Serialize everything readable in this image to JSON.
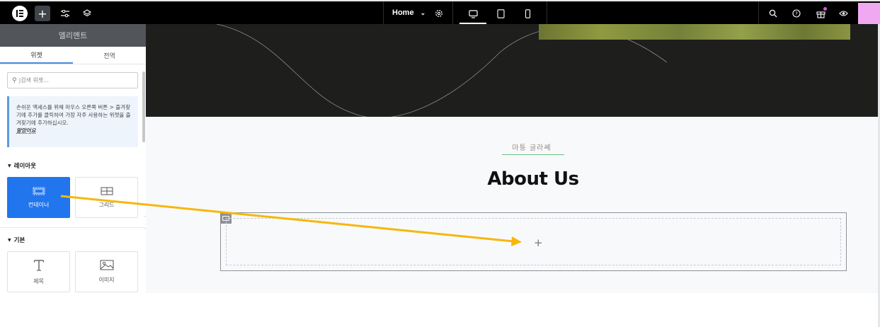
{
  "topbar": {
    "page_selector": "Home",
    "colors": {
      "background": "#000000",
      "accent_pink": "#f0a8f0"
    },
    "icons": [
      "elementor-logo-icon",
      "plus-icon",
      "sliders-icon",
      "layers-icon",
      "chevron-down-icon",
      "gear-icon",
      "desktop-icon",
      "tablet-icon",
      "mobile-icon",
      "search-icon",
      "help-icon",
      "gift-icon",
      "eye-icon"
    ]
  },
  "sidebar": {
    "title": "엘리멘트",
    "tabs": [
      {
        "label": "위젯",
        "active": true
      },
      {
        "label": "전역",
        "active": false
      }
    ],
    "search_placeholder": "|검색 위젯...",
    "info_text": "손쉬운 액세스를 위해 마우스 오른쪽 버튼 > 즐겨찾기에 추가를 클릭하여 가장 자주 사용하는 위젯을 즐겨찾기에 추가하십시오.",
    "info_link": "알았어요",
    "sections": [
      {
        "title": "레이아웃",
        "widgets": [
          {
            "label": "컨테이너",
            "icon": "container-icon",
            "highlighted": true
          },
          {
            "label": "그리드",
            "icon": "grid-icon",
            "highlighted": false
          }
        ]
      },
      {
        "title": "기본",
        "widgets": [
          {
            "label": "제목",
            "icon": "heading-icon",
            "highlighted": false
          },
          {
            "label": "이미지",
            "icon": "image-icon",
            "highlighted": false
          }
        ]
      }
    ],
    "accent_color": "#2175ed"
  },
  "canvas": {
    "subtitle": "마퉁 글라쎄",
    "heading": "About Us",
    "add_symbol": "+",
    "arrow_color": "#f5b80a"
  }
}
